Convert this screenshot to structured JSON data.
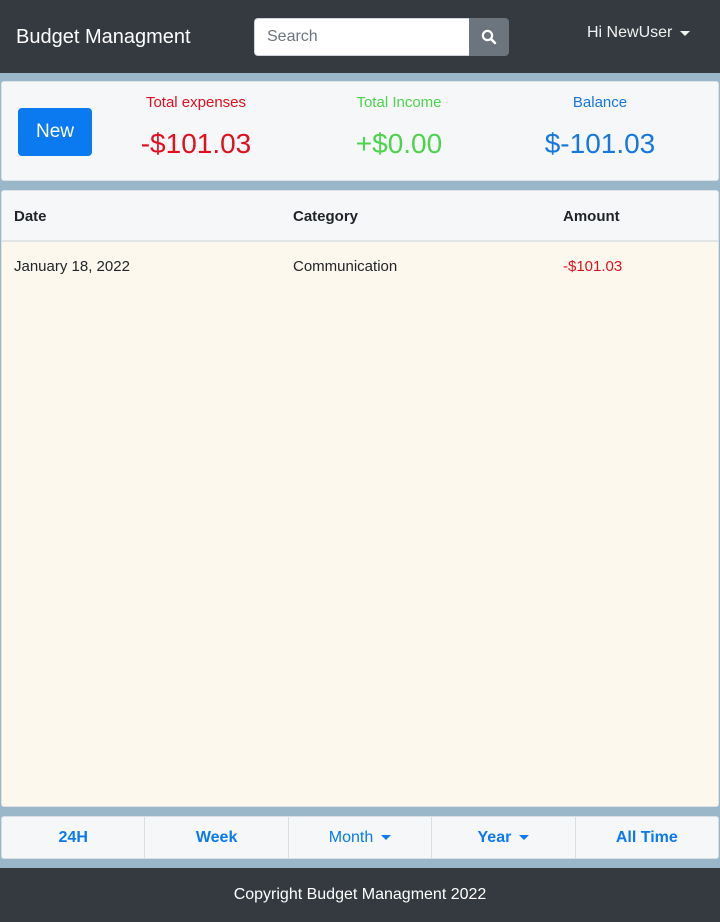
{
  "navbar": {
    "brand": "Budget Managment",
    "search_placeholder": "Search",
    "search_icon": "search-icon",
    "user_greeting": "Hi NewUser"
  },
  "summary": {
    "new_button": "New",
    "expenses": {
      "label": "Total expenses",
      "value": "-$101.03",
      "color": "#e0101c"
    },
    "income": {
      "label": "Total Income",
      "value": "+$0.00",
      "color": "#4cd44c"
    },
    "balance": {
      "label": "Balance",
      "value": "$-101.03",
      "color": "#1677e0"
    }
  },
  "table": {
    "headers": [
      "Date",
      "Category",
      "Amount"
    ],
    "rows": [
      {
        "date": "January 18, 2022",
        "category": "Communication",
        "amount": "-$101.03"
      }
    ],
    "amount_color": "#e0101c"
  },
  "periods": {
    "items": [
      "24H",
      "Week",
      "Month",
      "Year",
      "All Time"
    ]
  },
  "footer": {
    "text": "Copyright Budget Managment 2022"
  },
  "colors": {
    "navbar_bg": "#343a40",
    "accent": "#0b79f0",
    "page_bg": "#9ab6c9"
  }
}
